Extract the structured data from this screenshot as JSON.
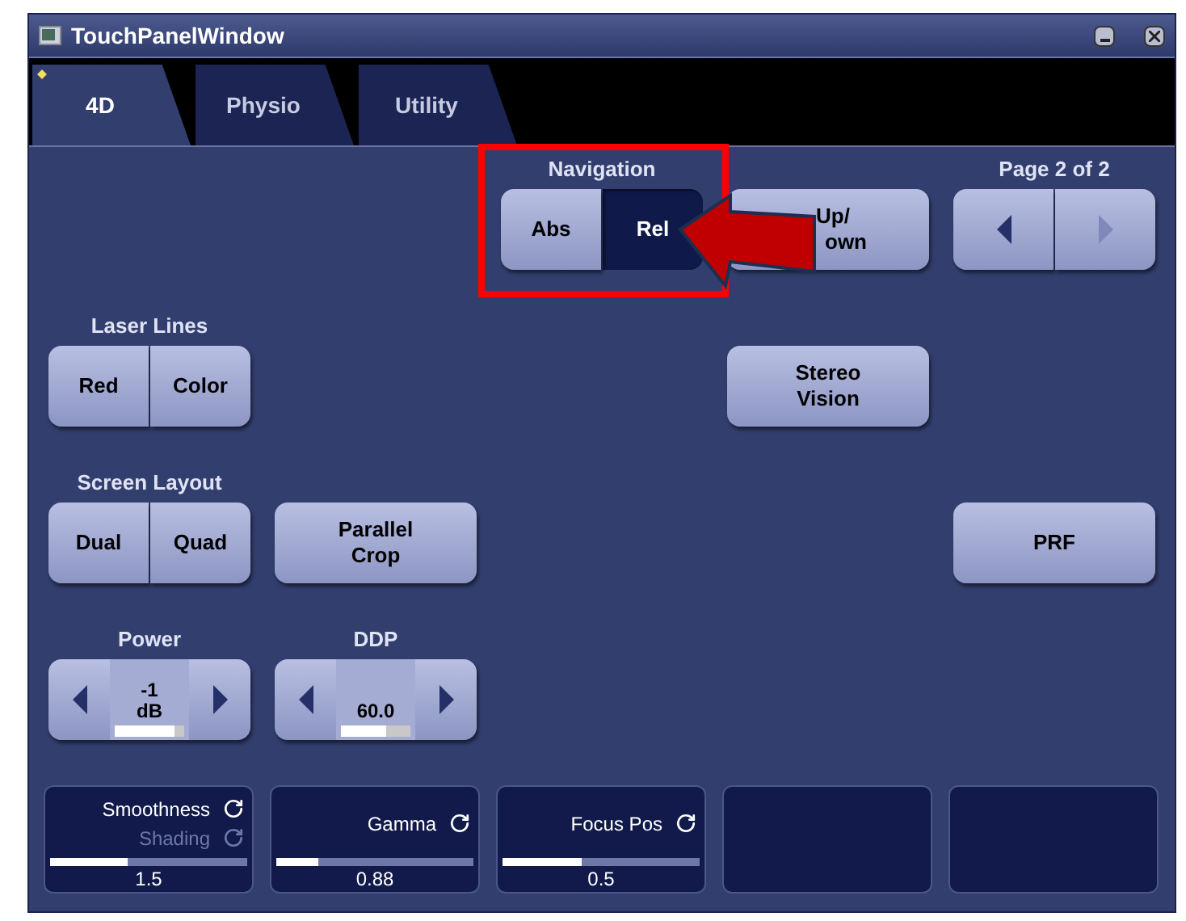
{
  "window": {
    "title": "TouchPanelWindow"
  },
  "tabs": [
    {
      "label": "4D",
      "selected": true
    },
    {
      "label": "Physio",
      "selected": false
    },
    {
      "label": "Utility",
      "selected": false
    }
  ],
  "navigation": {
    "label": "Navigation",
    "buttons": [
      {
        "label": "Abs",
        "selected": false
      },
      {
        "label": "Rel",
        "selected": true
      }
    ]
  },
  "up_down": {
    "label_lines": [
      "Up/",
      "own"
    ]
  },
  "page": {
    "label": "Page 2 of 2",
    "previous_disabled": false,
    "next_disabled": true
  },
  "laser_lines": {
    "label": "Laser Lines",
    "buttons": [
      {
        "label": "Red",
        "selected": false
      },
      {
        "label": "Color",
        "selected": false
      }
    ]
  },
  "stereo_vision": {
    "label_lines": [
      "Stereo",
      "Vision"
    ]
  },
  "screen_layout": {
    "label": "Screen Layout",
    "buttons": [
      {
        "label": "Dual",
        "selected": false
      },
      {
        "label": "Quad",
        "selected": false
      }
    ]
  },
  "parallel_crop": {
    "label_lines": [
      "Parallel",
      "Crop"
    ]
  },
  "prf": {
    "label_lines": [
      "PRF"
    ]
  },
  "power": {
    "label": "Power",
    "value_lines": [
      "-1",
      "dB"
    ],
    "level": 0.85
  },
  "ddp": {
    "label": "DDP",
    "value_lines": [
      "60.0"
    ],
    "level": 0.64
  },
  "cards": [
    {
      "kind": "parameter",
      "lines": [
        {
          "text": "Smoothness",
          "disabled": false
        },
        {
          "text": "Shading",
          "disabled": true
        }
      ],
      "level": 0.39,
      "value": "1.5"
    },
    {
      "kind": "parameter",
      "lines": [
        {
          "text": "Gamma",
          "disabled": false
        }
      ],
      "level": 0.21,
      "value": "0.88"
    },
    {
      "kind": "parameter",
      "lines": [
        {
          "text": "Focus Pos",
          "disabled": false
        }
      ],
      "level": 0.4,
      "value": "0.5"
    },
    {
      "kind": "blank"
    },
    {
      "kind": "blank"
    }
  ]
}
